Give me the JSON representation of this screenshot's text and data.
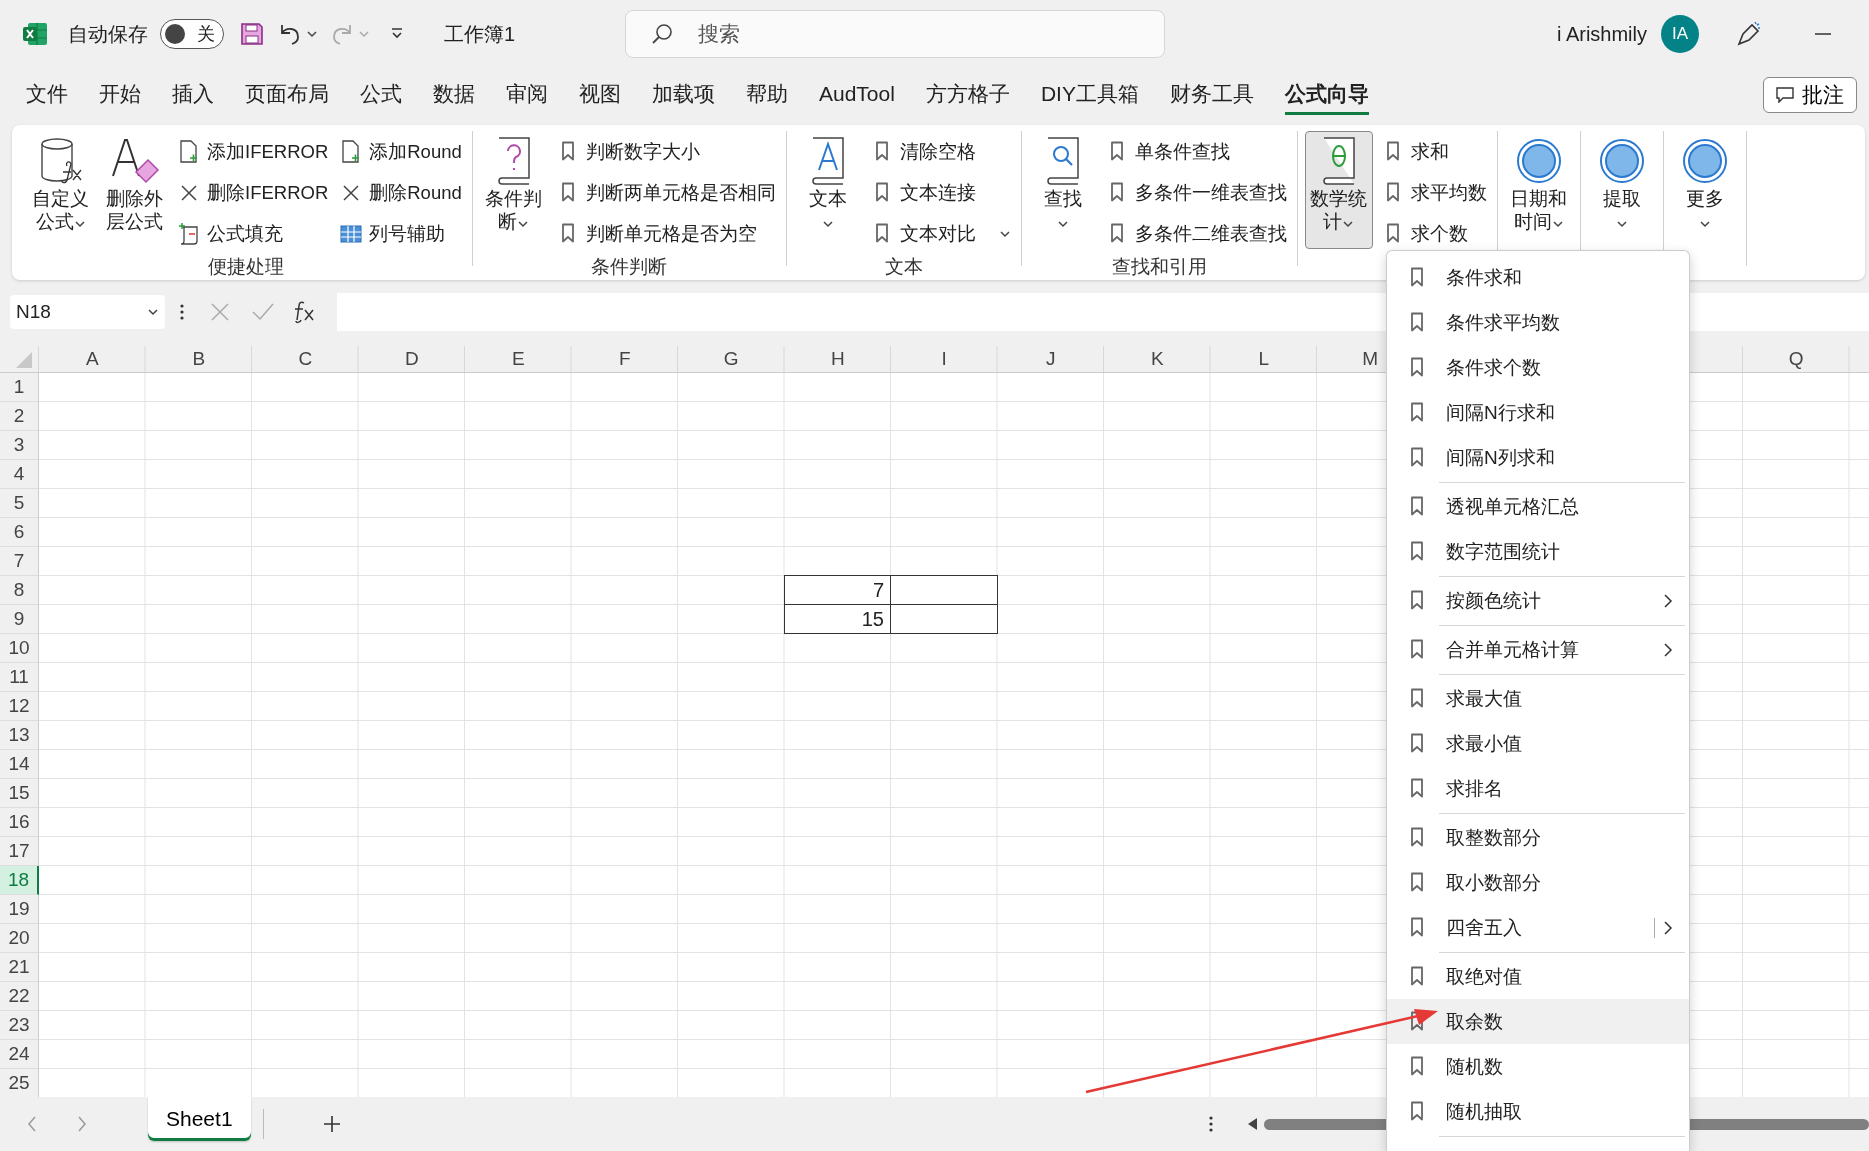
{
  "title_bar": {
    "autosave_label": "自动保存",
    "autosave": {
      "on": false,
      "label": "关"
    },
    "document_title": "工作簿1",
    "search": {
      "placeholder": "搜索"
    },
    "user_name": "i Arishmily",
    "avatar": "IA"
  },
  "tabs": [
    {
      "label": "文件",
      "selected": false
    },
    {
      "label": "开始",
      "selected": false
    },
    {
      "label": "插入",
      "selected": false
    },
    {
      "label": "页面布局",
      "selected": false
    },
    {
      "label": "公式",
      "selected": false
    },
    {
      "label": "数据",
      "selected": false
    },
    {
      "label": "审阅",
      "selected": false
    },
    {
      "label": "视图",
      "selected": false
    },
    {
      "label": "加载项",
      "selected": false
    },
    {
      "label": "帮助",
      "selected": false
    },
    {
      "label": "AudTool",
      "selected": false
    },
    {
      "label": "方方格子",
      "selected": false
    },
    {
      "label": "DIY工具箱",
      "selected": false
    },
    {
      "label": "财务工具",
      "selected": false
    },
    {
      "label": "公式向导",
      "selected": true
    }
  ],
  "comment_button": "批注",
  "ribbon": {
    "groups": [
      {
        "label": "便捷处理",
        "large": [
          {
            "label": "自定义公式",
            "dropdown": true,
            "pressed": false
          },
          {
            "label": "删除外层公式",
            "dropdown": false,
            "pressed": false
          }
        ],
        "columns": [
          [
            {
              "label": "添加IFERROR",
              "dropdown": false
            },
            {
              "label": "删除IFERROR",
              "dropdown": false
            },
            {
              "label": "公式填充",
              "dropdown": false
            }
          ],
          [
            {
              "label": "添加Round",
              "dropdown": false
            },
            {
              "label": "删除Round",
              "dropdown": false
            },
            {
              "label": "列号辅助",
              "dropdown": false
            }
          ]
        ]
      },
      {
        "label": "条件判断",
        "large": [
          {
            "label": "条件判断",
            "dropdown": true,
            "pressed": false
          }
        ],
        "columns": [
          [
            {
              "label": "判断数字大小",
              "dropdown": false
            },
            {
              "label": "判断两单元格是否相同",
              "dropdown": false
            },
            {
              "label": "判断单元格是否为空",
              "dropdown": false
            }
          ]
        ]
      },
      {
        "label": "文本",
        "large": [
          {
            "label": "文本",
            "dropdown": true,
            "pressed": false
          }
        ],
        "columns": [
          [
            {
              "label": "清除空格",
              "dropdown": false
            },
            {
              "label": "文本连接",
              "dropdown": false
            },
            {
              "label": "文本对比",
              "dropdown": true
            }
          ]
        ]
      },
      {
        "label": "查找和引用",
        "large": [
          {
            "label": "查找",
            "dropdown": true,
            "pressed": false
          }
        ],
        "columns": [
          [
            {
              "label": "单条件查找",
              "dropdown": false
            },
            {
              "label": "多条件一维表查找",
              "dropdown": false
            },
            {
              "label": "多条件二维表查找",
              "dropdown": false
            }
          ]
        ]
      },
      {
        "large": [
          {
            "label": "数学统计",
            "dropdown": true,
            "pressed": true
          }
        ],
        "columns": [
          [
            {
              "label": "求和",
              "dropdown": false
            },
            {
              "label": "求平均数",
              "dropdown": false
            },
            {
              "label": "求个数",
              "dropdown": false
            }
          ]
        ]
      },
      {
        "large": [
          {
            "label": "日期和时间",
            "dropdown": true,
            "pressed": false
          }
        ]
      },
      {
        "large": [
          {
            "label": "提取",
            "dropdown": true,
            "pressed": false
          }
        ]
      },
      {
        "large": [
          {
            "label": "更多",
            "dropdown": true,
            "pressed": false
          }
        ]
      }
    ]
  },
  "formula_bar": {
    "name_box": "N18"
  },
  "sheet": {
    "columns": [
      "A",
      "B",
      "C",
      "D",
      "E",
      "F",
      "G",
      "H",
      "I",
      "J",
      "K",
      "L",
      "M",
      null,
      null,
      null,
      "Q"
    ],
    "rows": [
      {
        "label": "1",
        "selected": false
      },
      {
        "label": "2",
        "selected": false
      },
      {
        "label": "3",
        "selected": false
      },
      {
        "label": "4",
        "selected": false
      },
      {
        "label": "5",
        "selected": false
      },
      {
        "label": "6",
        "selected": false
      },
      {
        "label": "7",
        "selected": false
      },
      {
        "label": "8",
        "selected": false,
        "cells": [
          null,
          null,
          null,
          null,
          null,
          null,
          null,
          {
            "value": "7",
            "bordered": true
          },
          {
            "bordered": true
          }
        ]
      },
      {
        "label": "9",
        "selected": false,
        "cells": [
          null,
          null,
          null,
          null,
          null,
          null,
          null,
          {
            "value": "15",
            "bordered": true
          },
          {
            "bordered": true
          }
        ]
      },
      {
        "label": "10",
        "selected": false
      },
      {
        "label": "11",
        "selected": false
      },
      {
        "label": "12",
        "selected": false
      },
      {
        "label": "13",
        "selected": false
      },
      {
        "label": "14",
        "selected": false
      },
      {
        "label": "15",
        "selected": false
      },
      {
        "label": "16",
        "selected": false
      },
      {
        "label": "17",
        "selected": false
      },
      {
        "label": "18",
        "selected": true
      },
      {
        "label": "19",
        "selected": false
      },
      {
        "label": "20",
        "selected": false
      },
      {
        "label": "21",
        "selected": false
      },
      {
        "label": "22",
        "selected": false
      },
      {
        "label": "23",
        "selected": false
      },
      {
        "label": "24",
        "selected": false
      },
      {
        "label": "25",
        "selected": false
      }
    ]
  },
  "menu": {
    "groups": [
      [
        {
          "label": "条件求和",
          "submenu": false,
          "hovered": false
        },
        {
          "label": "条件求平均数",
          "submenu": false,
          "hovered": false
        },
        {
          "label": "条件求个数",
          "submenu": false,
          "hovered": false
        },
        {
          "label": "间隔N行求和",
          "submenu": false,
          "hovered": false
        },
        {
          "label": "间隔N列求和",
          "submenu": false,
          "hovered": false
        }
      ],
      [
        {
          "label": "透视单元格汇总",
          "submenu": false,
          "hovered": false
        },
        {
          "label": "数字范围统计",
          "submenu": false,
          "hovered": false
        }
      ],
      [
        {
          "label": "按颜色统计",
          "submenu": true,
          "split": false,
          "hovered": false
        }
      ],
      [
        {
          "label": "合并单元格计算",
          "submenu": true,
          "split": false,
          "hovered": false
        }
      ],
      [
        {
          "label": "求最大值",
          "submenu": false,
          "hovered": false
        },
        {
          "label": "求最小值",
          "submenu": false,
          "hovered": false
        },
        {
          "label": "求排名",
          "submenu": false,
          "hovered": false
        }
      ],
      [
        {
          "label": "取整数部分",
          "submenu": false,
          "hovered": false
        },
        {
          "label": "取小数部分",
          "submenu": false,
          "hovered": false
        },
        {
          "label": "四舍五入",
          "submenu": true,
          "split": true,
          "hovered": false
        }
      ],
      [
        {
          "label": "取绝对值",
          "submenu": false,
          "hovered": false
        },
        {
          "label": "取余数",
          "submenu": false,
          "hovered": true
        },
        {
          "label": "随机数",
          "submenu": false,
          "hovered": false
        },
        {
          "label": "随机抽取",
          "submenu": false,
          "hovered": false
        }
      ]
    ]
  },
  "sheet_tabs": [
    {
      "label": "Sheet1",
      "selected": true
    }
  ]
}
